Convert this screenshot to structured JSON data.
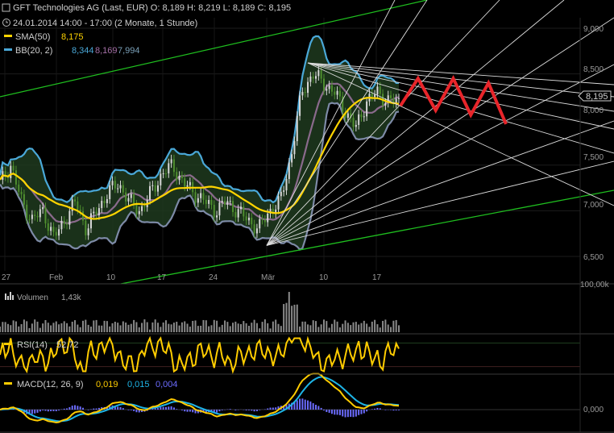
{
  "header": {
    "line1": "GFT Technologies AG (Last, EUR)  O: 8,189  H: 8,219  L: 8,189  C: 8,195",
    "line2": "24.01.2014 14:00 - 17:00 (2 Monate, 1 Stunde)",
    "sma_label": "SMA(50)",
    "sma_value": "8,175",
    "bb_label": "BB(20, 2)",
    "bb_upper": "8,344",
    "bb_mid": "8,169",
    "bb_lower": "7,994"
  },
  "colors": {
    "background": "#000000",
    "sma": "#ffd400",
    "bb_outer": "#4aa8d8",
    "bb_mid": "#8a6a8c",
    "bb_fill": "#1f3a1f",
    "channel": "#1fbf1f",
    "forecast": "#e8252a",
    "fan": "#dcdcdc",
    "rsi": "#ffcc00",
    "macd": "#ffcc00",
    "signal": "#1eb4e6",
    "hist": "#6c6cff",
    "last_price_box": "#000000"
  },
  "price_panel": {
    "y_ticks": [
      "9,000",
      "8,500",
      "8,000",
      "7,500",
      "7,000",
      "6,500"
    ],
    "x_ticks": [
      "27",
      "Feb",
      "10",
      "17",
      "24",
      "Mär",
      "10",
      "17"
    ],
    "last_price_label": "8,195"
  },
  "volume_panel": {
    "label": "Volumen",
    "value": "1,43k",
    "top_tick": "100,00k"
  },
  "rsi_panel": {
    "label": "RSI(14)",
    "value": "52,72"
  },
  "macd_panel": {
    "label": "MACD(12, 26, 9)",
    "macd_value": "0,019",
    "signal_value": "0,015",
    "hist_value": "0,004",
    "zero_tick": "0,000"
  },
  "chart_data": {
    "type": "line",
    "title": "GFT Technologies AG (Last, EUR)",
    "instrument": "GFT Technologies AG",
    "interval": "1 Stunde",
    "period": "2 Monate",
    "x_tick_labels": [
      "27",
      "Feb",
      "10",
      "17",
      "24",
      "Mär",
      "10",
      "17"
    ],
    "y_tick_labels": [
      "6,500",
      "7,000",
      "7,500",
      "8,000",
      "8,500",
      "9,000"
    ],
    "ylim": [
      6.2,
      9.2
    ],
    "last": {
      "open": 8.189,
      "high": 8.219,
      "low": 8.189,
      "close": 8.195
    },
    "series": [
      {
        "name": "SMA(50)",
        "last_value": 8.175
      },
      {
        "name": "BB(20, 2)",
        "upper": 8.344,
        "middle": 8.169,
        "lower": 7.994
      }
    ],
    "close_approx": [
      7.3,
      7.5,
      7.1,
      6.9,
      7.0,
      6.7,
      6.9,
      7.1,
      6.8,
      7.0,
      7.2,
      7.3,
      7.1,
      7.0,
      7.2,
      7.4,
      7.5,
      7.3,
      7.2,
      7.1,
      7.0,
      7.1,
      7.0,
      6.9,
      6.8,
      7.0,
      7.1,
      7.6,
      8.3,
      8.5,
      8.4,
      8.3,
      8.1,
      7.9,
      8.2,
      8.3,
      8.2,
      8.2
    ],
    "forecast_zigzag": [
      8.15,
      8.45,
      8.1,
      8.45,
      8.05,
      8.4,
      7.95
    ],
    "indicators": {
      "volume_last_k": 1.43,
      "rsi14_last": 52.72,
      "macd_last": 0.019,
      "signal_last": 0.015,
      "histogram_last": 0.004
    }
  }
}
